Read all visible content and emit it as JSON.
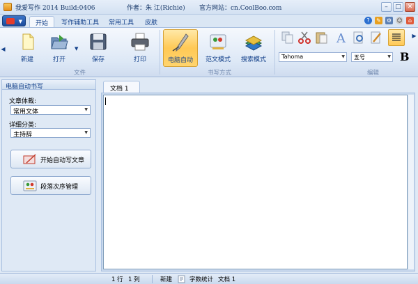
{
  "window": {
    "title": "我爱写作 2014 Build:0406",
    "author": "作者：朱 江(Richie)",
    "website": "官方网站：cn.CoolBoo.com",
    "controls": [
      "–",
      "□",
      "✕"
    ]
  },
  "tabs": [
    "开始",
    "写作辅助工具",
    "常用工具",
    "皮肤"
  ],
  "ribbon": {
    "buttons": {
      "new": "新建",
      "open": "打开",
      "save": "保存",
      "print": "打印",
      "auto": "电脑自动",
      "sample": "范文模式",
      "search": "搜索模式"
    },
    "groups": {
      "file": "文件",
      "write_mode": "书写方式",
      "edit": "编辑"
    },
    "font_name": "Tahoma",
    "font_size": "五号",
    "bold": "B"
  },
  "panel": {
    "header": "电脑自动书写",
    "genre_label": "文章体裁:",
    "genre_value": "常用文体",
    "category_label": "详细分类:",
    "category_value": "主持辞",
    "start_button": "开始自动写文章",
    "order_button": "段落次序管理"
  },
  "document": {
    "tab_label": "文档 1"
  },
  "statusbar": {
    "line": "1 行",
    "col": "1 列",
    "new": "新建",
    "word_count": "字数统计",
    "doc": "文档 1"
  },
  "colors": {
    "accent": "#15428b",
    "selected": "#ffc956",
    "background": "#dfe9f5"
  }
}
